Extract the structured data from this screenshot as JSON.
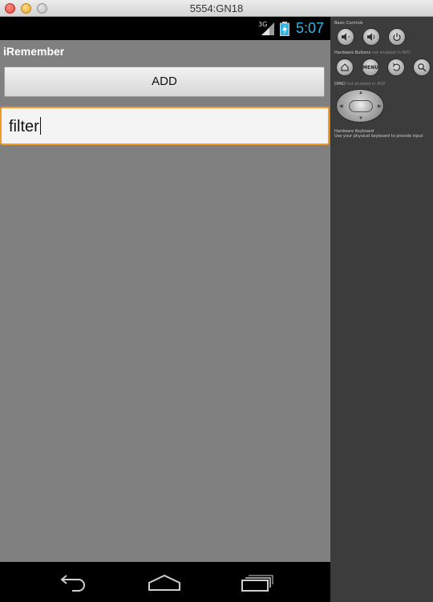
{
  "window": {
    "title": "5554:GN18"
  },
  "statusbar": {
    "network": "3G",
    "time": "5:07"
  },
  "app": {
    "title": "iRemember",
    "add_label": "ADD",
    "filter_value": "filter"
  },
  "navbar": {
    "icons": [
      "back-icon",
      "home-icon",
      "recent-apps-icon"
    ]
  },
  "panel": {
    "basic_controls_label": "Basic Controls",
    "hardware_buttons_label": "Hardware Buttons",
    "hardware_buttons_note": "not enabled in AVD",
    "dpad_label": "DPAD",
    "dpad_note": "not enabled in AVD",
    "keyboard_label": "Hardware Keyboard",
    "keyboard_note": "Use your physical keyboard to provide input",
    "menu_label": "MENU"
  },
  "colors": {
    "clock": "#33b5e5",
    "focus_border": "#f19a26",
    "screen_bg": "#808080"
  }
}
